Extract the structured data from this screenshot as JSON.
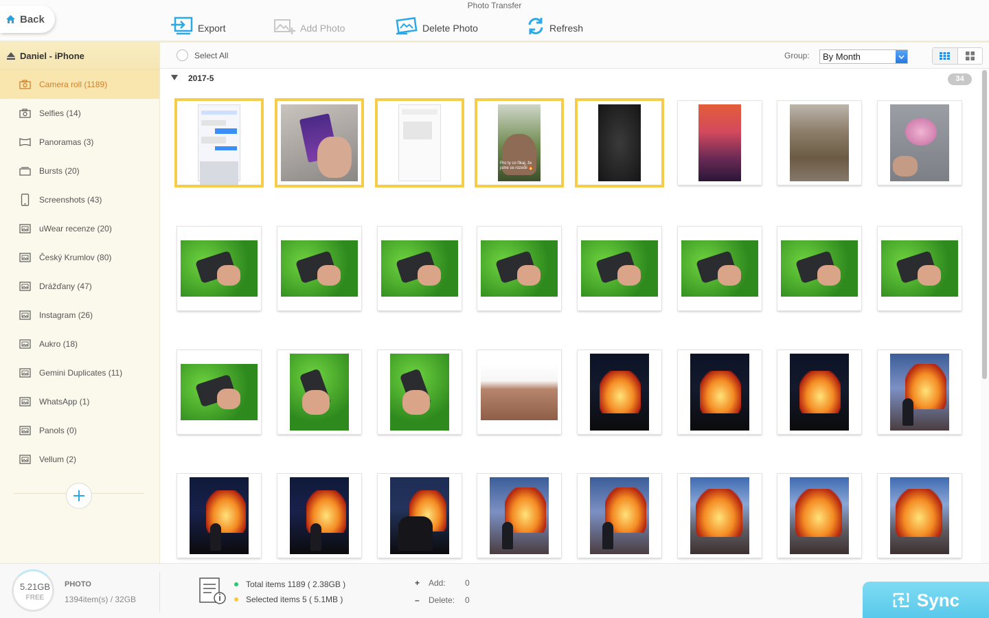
{
  "app": {
    "title": "Photo Transfer"
  },
  "toolbar": {
    "back_label": "Back",
    "export_label": "Export",
    "add_photo_label": "Add Photo",
    "delete_photo_label": "Delete Photo",
    "refresh_label": "Refresh"
  },
  "sidebar": {
    "device_name": "Daniel - iPhone",
    "items": [
      {
        "label": "Camera roll (1189)",
        "icon": "camera-icon",
        "active": true
      },
      {
        "label": "Selfies (14)",
        "icon": "selfie-camera-icon"
      },
      {
        "label": "Panoramas (3)",
        "icon": "panorama-icon"
      },
      {
        "label": "Bursts (20)",
        "icon": "burst-icon"
      },
      {
        "label": "Screenshots (43)",
        "icon": "phone-icon"
      },
      {
        "label": "uWear recenze (20)",
        "icon": "album-icon"
      },
      {
        "label": "Český Krumlov (80)",
        "icon": "album-icon"
      },
      {
        "label": "Drážďany (47)",
        "icon": "album-icon"
      },
      {
        "label": "Instagram (26)",
        "icon": "album-icon"
      },
      {
        "label": "Aukro (18)",
        "icon": "album-icon"
      },
      {
        "label": "Gemini Duplicates (11)",
        "icon": "album-icon"
      },
      {
        "label": "WhatsApp (1)",
        "icon": "album-icon"
      },
      {
        "label": "Panols (0)",
        "icon": "album-icon"
      },
      {
        "label": "Vellum (2)",
        "icon": "album-icon"
      }
    ]
  },
  "content": {
    "select_all_label": "Select All",
    "group_label": "Group:",
    "group_value": "By Month",
    "group": {
      "title": "2017-5",
      "count": "34"
    }
  },
  "photos": [
    {
      "kind": "screenshot-chat",
      "selected": true
    },
    {
      "kind": "candy-bag",
      "selected": true
    },
    {
      "kind": "screenshot-blank",
      "selected": true
    },
    {
      "kind": "selfie-story",
      "selected": true,
      "caption": "Pro ty co říkaj, že jsme se rozešli 🔥"
    },
    {
      "kind": "dark-texture",
      "selected": true
    },
    {
      "kind": "city-sunset",
      "selected": false
    },
    {
      "kind": "ground-fence",
      "selected": false
    },
    {
      "kind": "flowers-hand",
      "selected": false
    },
    {
      "kind": "phone-grass",
      "selected": false
    },
    {
      "kind": "phone-grass",
      "selected": false
    },
    {
      "kind": "phone-grass",
      "selected": false
    },
    {
      "kind": "phone-grass",
      "selected": false
    },
    {
      "kind": "phone-grass",
      "selected": false
    },
    {
      "kind": "phone-grass",
      "selected": false
    },
    {
      "kind": "phone-grass",
      "selected": false
    },
    {
      "kind": "phone-grass",
      "selected": false
    },
    {
      "kind": "phone-grass",
      "selected": false
    },
    {
      "kind": "phone-grass-portrait",
      "selected": false
    },
    {
      "kind": "phone-grass-portrait",
      "selected": false
    },
    {
      "kind": "skin-closeup",
      "selected": false
    },
    {
      "kind": "bonfire-night",
      "selected": false
    },
    {
      "kind": "bonfire-night",
      "selected": false
    },
    {
      "kind": "bonfire-night",
      "selected": false
    },
    {
      "kind": "bonfire-dusk-child",
      "selected": false
    },
    {
      "kind": "bonfire-night-child",
      "selected": false
    },
    {
      "kind": "bonfire-night-child",
      "selected": false
    },
    {
      "kind": "bonfire-night-people",
      "selected": false
    },
    {
      "kind": "bonfire-dusk-child",
      "selected": false
    },
    {
      "kind": "bonfire-dusk-child",
      "selected": false
    },
    {
      "kind": "bonfire-dusk",
      "selected": false
    },
    {
      "kind": "bonfire-dusk",
      "selected": false
    },
    {
      "kind": "bonfire-dusk",
      "selected": false
    }
  ],
  "footer": {
    "free_space": "5.21GB",
    "free_label": "FREE",
    "type_label": "PHOTO",
    "items_capacity": "1394item(s) / 32GB",
    "total_items": "Total items 1189 ( 2.38GB )",
    "selected_items": "Selected items 5 ( 5.1MB )",
    "add_label": "Add:",
    "add_value": "0",
    "delete_label": "Delete:",
    "delete_value": "0",
    "sync_label": "Sync"
  },
  "colors": {
    "accent": "#f5cd4a",
    "sidebar_active": "#f8e6ae",
    "active_text": "#d2802b",
    "brand_blue": "#29a9e8",
    "sync_button": "#6bd3ef",
    "total_dot": "#2fc872",
    "selected_dot": "#f4c93b"
  }
}
